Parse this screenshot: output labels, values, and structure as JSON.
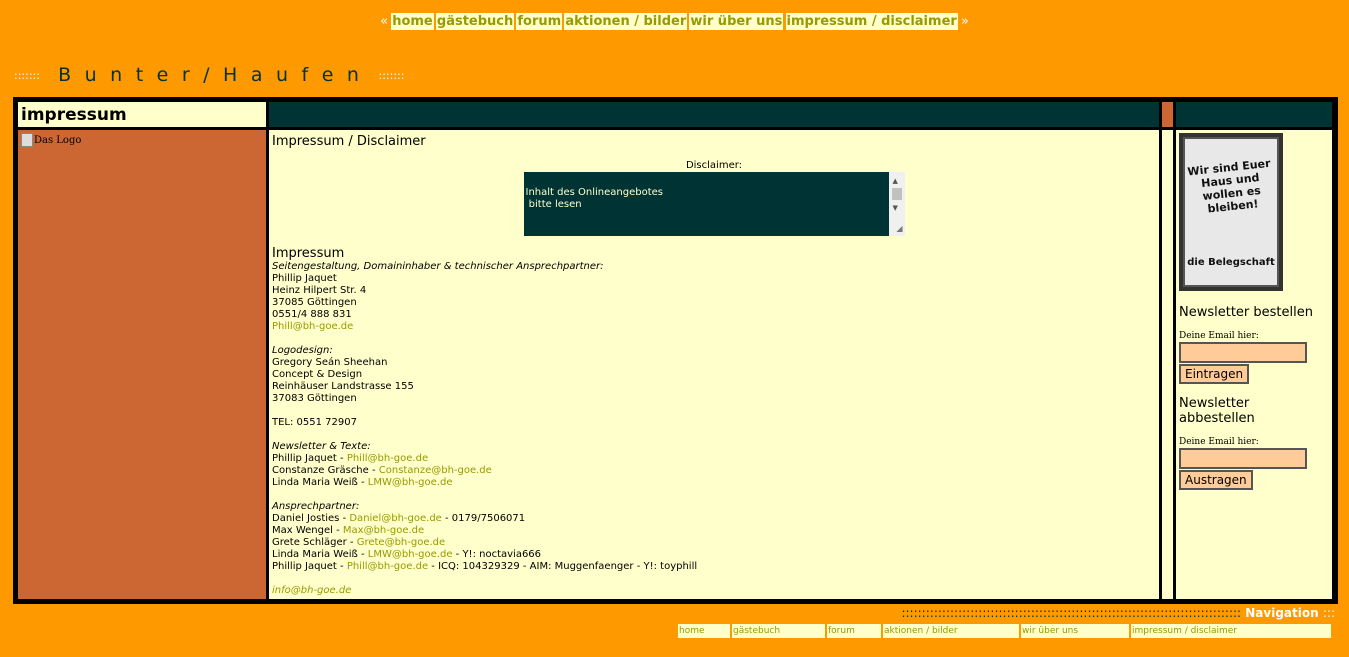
{
  "top_nav": {
    "open": "«",
    "close": "»",
    "items": [
      "home",
      "gästebuch",
      "forum",
      "aktionen / bilder",
      "wir über uns",
      "impressum / disclaimer"
    ]
  },
  "site_title": {
    "dots_left": ":::::::",
    "name": "Bunter/Haufen",
    "dots_right": ":::::::"
  },
  "page_heading": "impressum",
  "logo_alt": "Das Logo",
  "main": {
    "title": "Impressum / Disclaimer",
    "disclaimer_label": "Disclaimer:",
    "disclaimer_text": [
      "Inhalt des Onlineangebotes",
      " bitte lesen"
    ],
    "impressum_heading": "Impressum",
    "design_role": "Seitengestaltung, Domaininhaber & technischer Ansprechpartner:",
    "owner": [
      "Phillip Jaquet",
      "Heinz Hilpert Str. 4",
      "37085 Göttingen",
      "0551/4 888 831"
    ],
    "owner_email": "Phill@bh-goe.de",
    "logo_role": "Logodesign:",
    "logo_designer": [
      "Gregory Seán Sheehan",
      "Concept & Design",
      "Reinhäuser Landstrasse 155",
      "37083 Göttingen"
    ],
    "tel": "TEL: 0551 72907",
    "newsletter_role": "Newsletter & Texte:",
    "newsletter_people": [
      {
        "name": "Phillip Jaquet - ",
        "email": "Phill@bh-goe.de",
        "extra": ""
      },
      {
        "name": "Constanze Gräsche - ",
        "email": "Constanze@bh-goe.de",
        "extra": ""
      },
      {
        "name": "Linda Maria Weiß - ",
        "email": "LMW@bh-goe.de",
        "extra": ""
      }
    ],
    "contact_role": "Ansprechpartner:",
    "contacts": [
      {
        "name": "Daniel Josties - ",
        "email": "Daniel@bh-goe.de",
        "extra": " - 0179/7506071"
      },
      {
        "name": "Max Wengel - ",
        "email": "Max@bh-goe.de",
        "extra": ""
      },
      {
        "name": "Grete Schläger - ",
        "email": "Grete@bh-goe.de",
        "extra": ""
      },
      {
        "name": "Linda Maria Weiß - ",
        "email": "LMW@bh-goe.de",
        "extra": " - Y!: noctavia666"
      },
      {
        "name": "Phillip Jaquet - ",
        "email": "Phill@bh-goe.de",
        "extra": " - ICQ: 104329329 - AIM: Muggenfaenger - Y!: toyphill"
      }
    ],
    "info_email": "info@bh-goe.de"
  },
  "poster": {
    "line1": "Wir sind Euer Haus und wollen es bleiben!",
    "line2": "die Belegschaft"
  },
  "newsletter": {
    "subscribe_heading": "Newsletter bestellen",
    "subscribe_label": "Deine Email hier:",
    "subscribe_button": "Eintragen",
    "unsubscribe_heading": "Newsletter abbestellen",
    "unsubscribe_label": "Deine Email hier:",
    "unsubscribe_button": "Austragen"
  },
  "bottom_nav": {
    "dots_left": "::::::::::::::::::::::::::::::::::::::::::::::::::::::::::::::::::::::::::::::::::::",
    "title": "Navigation",
    "dots_right": ":::",
    "items": [
      "home",
      "gästebuch",
      "forum",
      "aktionen / bilder",
      "wir über uns",
      "impressum / disclaimer"
    ]
  },
  "colors": {
    "background": "#ff9900",
    "panel": "#ffffcc",
    "dark": "#003333",
    "accent": "#cc6633",
    "link": "#999900"
  }
}
